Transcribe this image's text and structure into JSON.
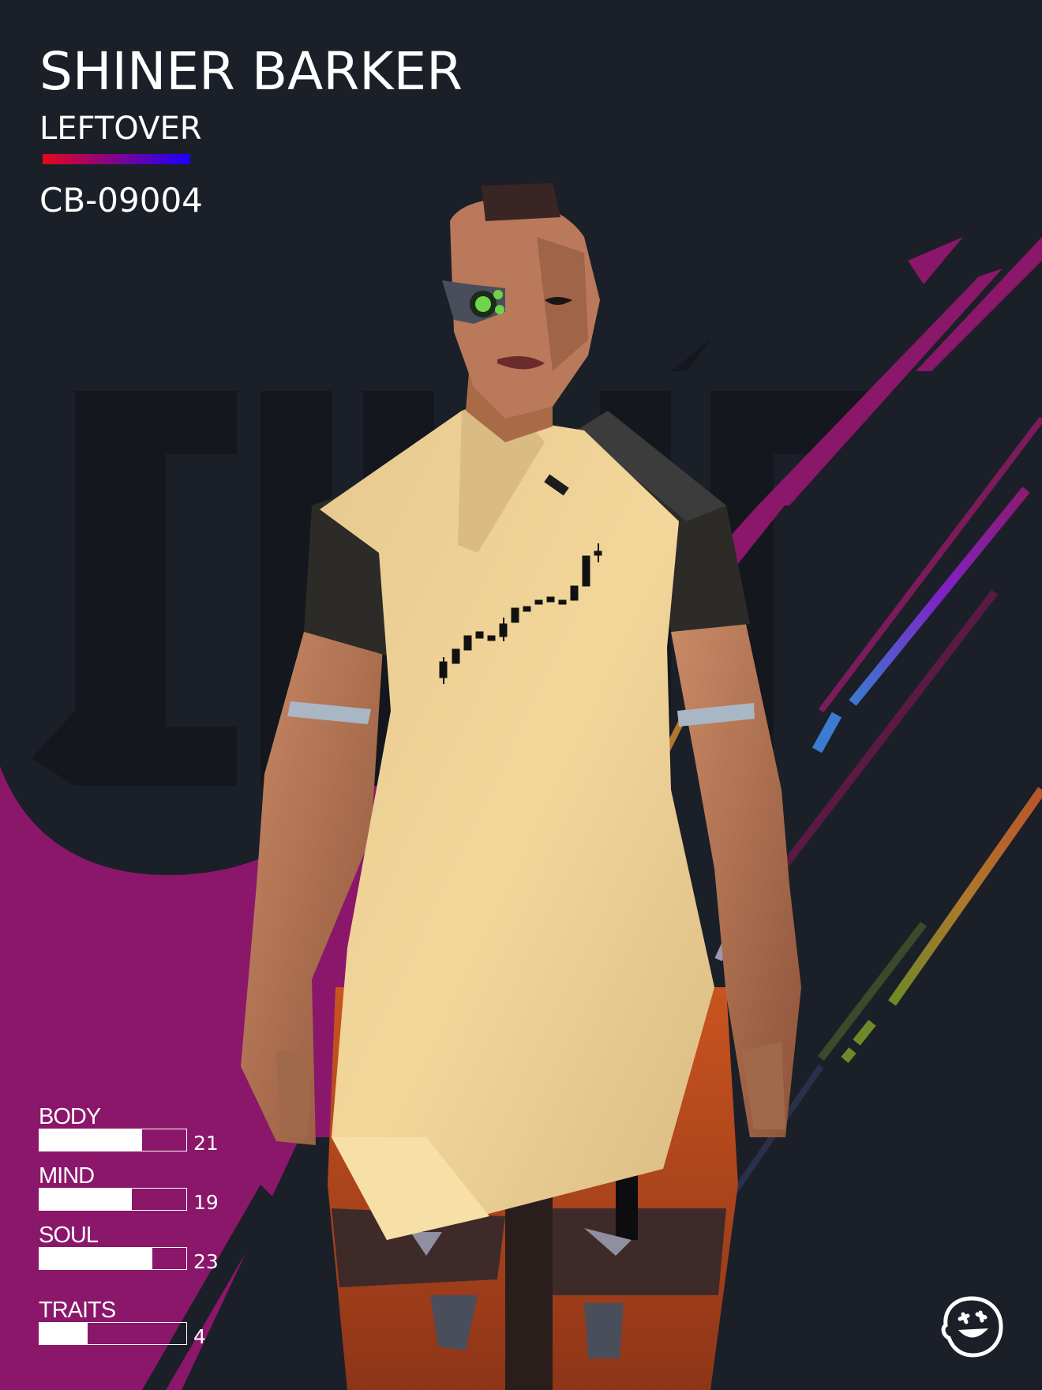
{
  "character": {
    "name": "SHINER BARKER",
    "class": "LEFTOVER",
    "serial": "CB-09004"
  },
  "colors": {
    "background": "#1b1f28",
    "accent_magenta": "#8a176a",
    "class_gradient_start": "#e2081d",
    "class_gradient_end": "#1b00ff"
  },
  "stats": [
    {
      "label": "BODY",
      "value": "21",
      "fill": 0.7
    },
    {
      "label": "MIND",
      "value": "19",
      "fill": 0.63
    },
    {
      "label": "SOUL",
      "value": "23",
      "fill": 0.77
    }
  ],
  "traits": {
    "label": "TRAITS",
    "value": "4",
    "fill": 0.33
  },
  "icons": {
    "brand_logo": "smiley-face-logo-icon"
  }
}
